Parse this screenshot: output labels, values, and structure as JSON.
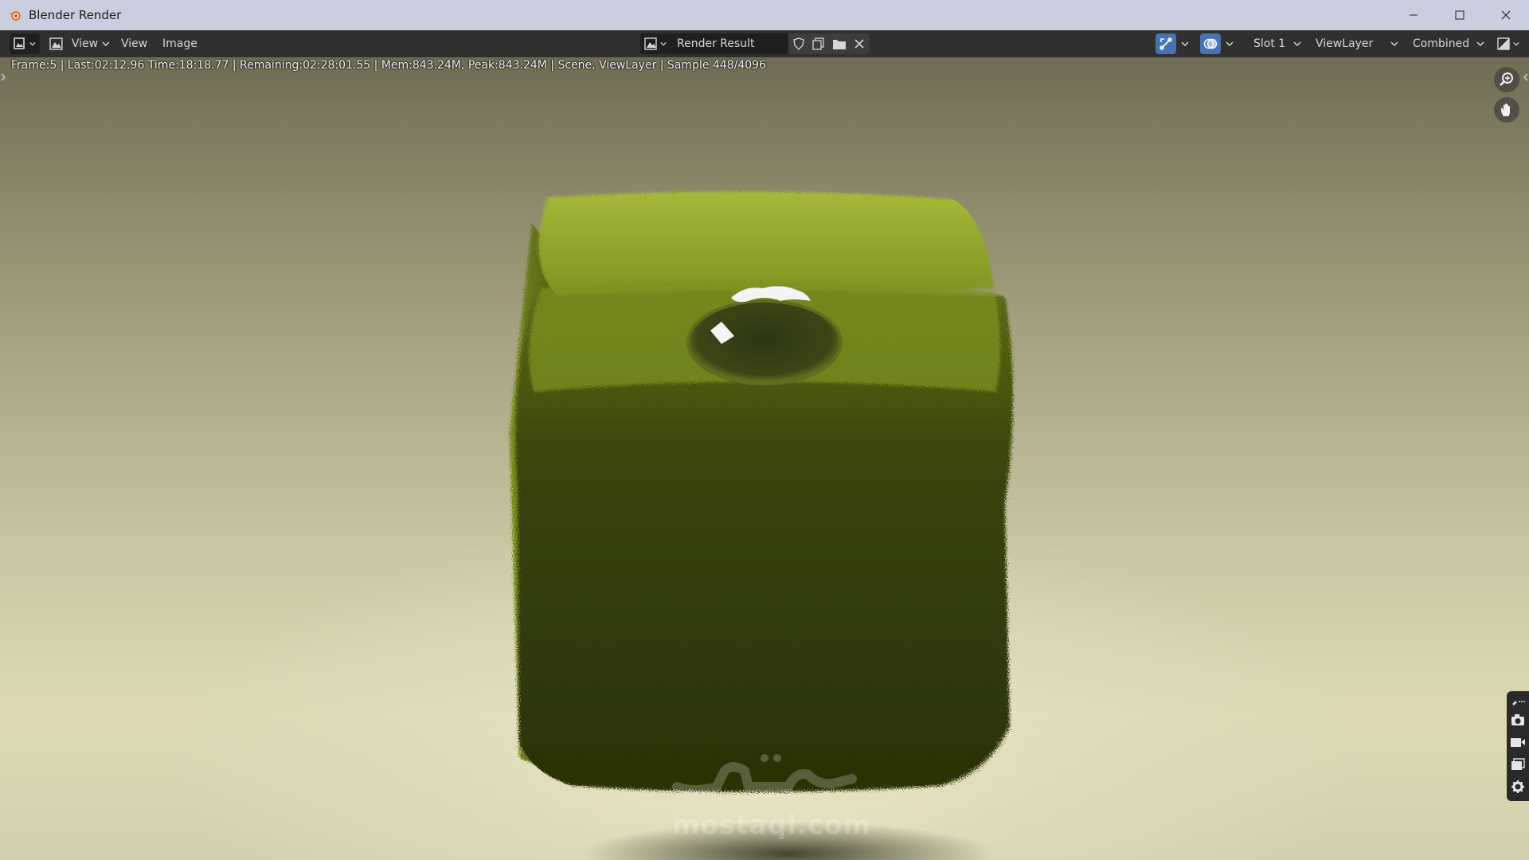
{
  "window": {
    "title": "Blender Render"
  },
  "header": {
    "mode_label": "View",
    "menus": [
      "View",
      "Image"
    ],
    "image_name": "Render Result",
    "slot": "Slot 1",
    "view_layer": "ViewLayer",
    "pass": "Combined"
  },
  "status": {
    "text": "Frame:5 | Last:02:12.96 Time:18:18.77 | Remaining:02:28:01.55 | Mem:843.24M, Peak:843.24M | Scene, ViewLayer | Sample 448/4096"
  },
  "watermark": {
    "url": "mostaql.com"
  },
  "colors": {
    "accent": "#4772b3",
    "header_bg": "#303030",
    "titlebar_bg": "#c9cfdf",
    "grass": "#7a8a1e"
  },
  "icons": {
    "app": "blender-logo-icon",
    "zoom": "zoom-icon",
    "pan": "hand-pan-icon",
    "tabs": [
      "tool-icon",
      "render-icon",
      "output-icon",
      "view-layer-icon",
      "scene-icon"
    ]
  }
}
